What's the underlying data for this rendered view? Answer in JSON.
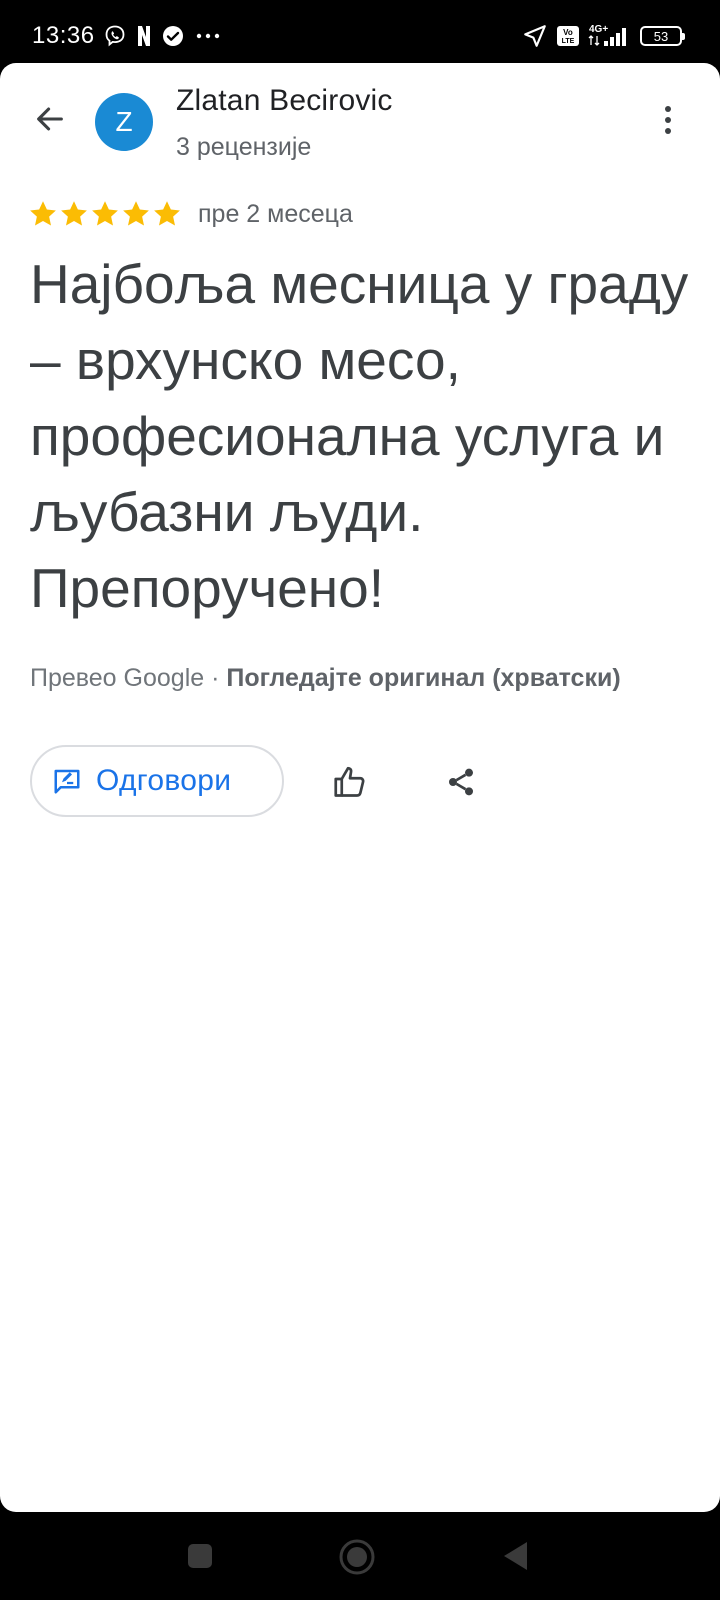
{
  "status_bar": {
    "time": "13:36",
    "battery_level": "53",
    "network_label": "4G+",
    "volte_label": "Vo LTE",
    "notification_icons": [
      "viber-icon",
      "netflix-icon",
      "check-circle-icon",
      "more-dots-icon"
    ]
  },
  "review": {
    "author_name": "Zlatan Becirovic",
    "avatar_initial": "Z",
    "avatar_color": "#1a8ad4",
    "review_count": "3 рецензије",
    "rating": 5,
    "max_rating": 5,
    "star_color": "#fbbc04",
    "date": "пре 2 месеца",
    "text": "Најбоља месница у граду – врхунско месо, професионална услуга и љубазни људи. Препоручено!",
    "translated_by": "Превео Google",
    "separator": " · ",
    "view_original": "Погледајте оригинал (хрватски)"
  },
  "actions": {
    "reply_label": "Одговори",
    "accent_color": "#1a73e8"
  }
}
